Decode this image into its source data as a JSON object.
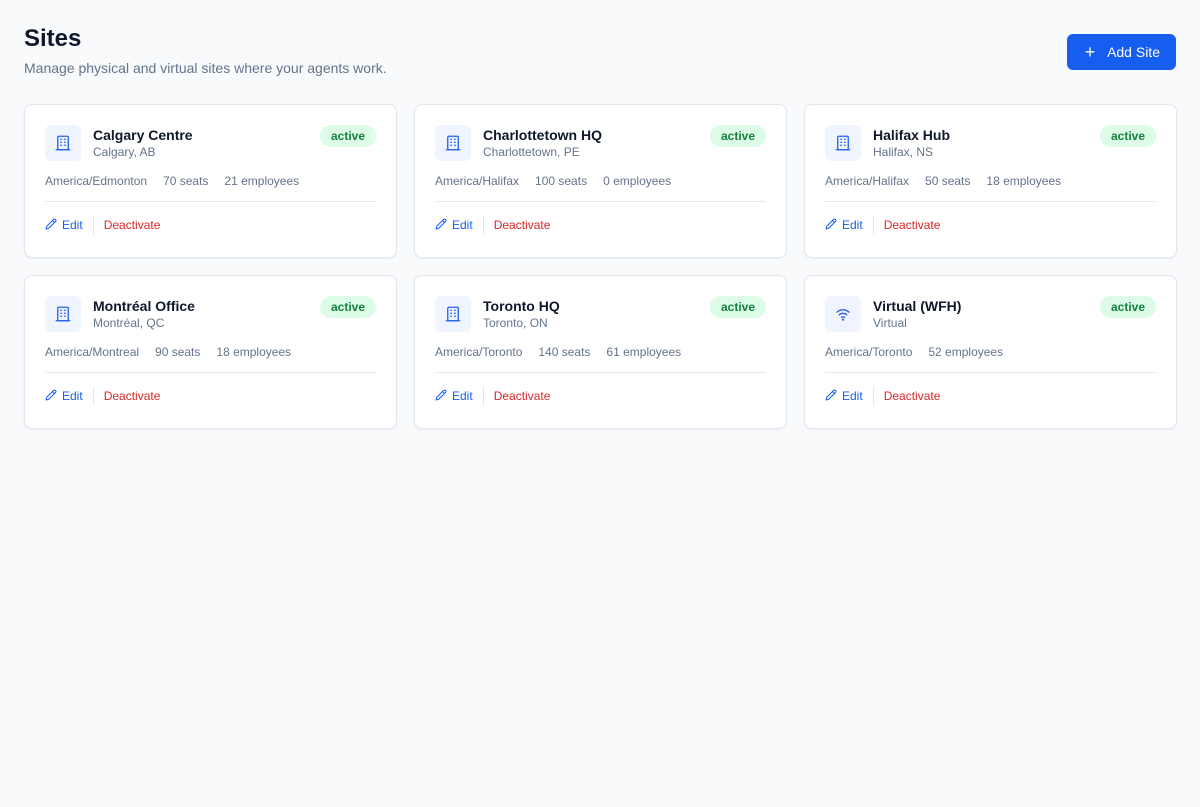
{
  "header": {
    "title": "Sites",
    "subtitle": "Manage physical and virtual sites where your agents work.",
    "add_button": "Add Site"
  },
  "colors": {
    "accent": "#155eef",
    "active_badge_bg": "#dcfce7",
    "active_badge_text": "#15803d",
    "danger": "#dc2626"
  },
  "actions": {
    "edit": "Edit",
    "deactivate": "Deactivate"
  },
  "sites": [
    {
      "name": "Calgary Centre",
      "location": "Calgary, AB",
      "status": "active",
      "timezone": "America/Edmonton",
      "seats": "70 seats",
      "employees": "21 employees",
      "icon": "building-icon"
    },
    {
      "name": "Charlottetown HQ",
      "location": "Charlottetown, PE",
      "status": "active",
      "timezone": "America/Halifax",
      "seats": "100 seats",
      "employees": "0 employees",
      "icon": "building-icon"
    },
    {
      "name": "Halifax Hub",
      "location": "Halifax, NS",
      "status": "active",
      "timezone": "America/Halifax",
      "seats": "50 seats",
      "employees": "18 employees",
      "icon": "building-icon"
    },
    {
      "name": "Montréal Office",
      "location": "Montréal, QC",
      "status": "active",
      "timezone": "America/Montreal",
      "seats": "90 seats",
      "employees": "18 employees",
      "icon": "building-icon"
    },
    {
      "name": "Toronto HQ",
      "location": "Toronto, ON",
      "status": "active",
      "timezone": "America/Toronto",
      "seats": "140 seats",
      "employees": "61 employees",
      "icon": "building-icon"
    },
    {
      "name": "Virtual (WFH)",
      "location": "Virtual",
      "status": "active",
      "timezone": "America/Toronto",
      "seats": "",
      "employees": "52 employees",
      "icon": "wifi-icon"
    }
  ]
}
